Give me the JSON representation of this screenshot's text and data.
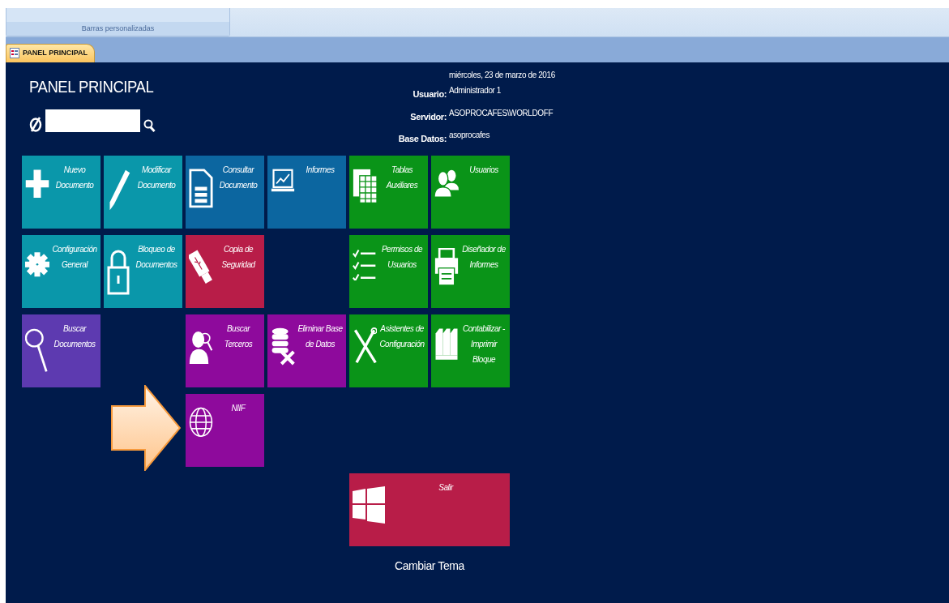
{
  "ribbon": {
    "group_label": "Barras personalizadas"
  },
  "document_tab": {
    "label": "PANEL PRINCIPAL",
    "selected": true
  },
  "panel": {
    "title": "PANEL PRINCIPAL",
    "info": {
      "date": "miércoles, 23 de marzo de 2016",
      "fields": [
        {
          "label": "Usuario:",
          "value": "Administrador 1"
        },
        {
          "label": "Servidor:",
          "value": "ASOPROCAFES\\WORLDOFF"
        },
        {
          "label": "Base Datos:",
          "value": "asoprocafes"
        }
      ]
    }
  },
  "tiles": [
    {
      "label": "Nuevo Documento",
      "color": "#0a97aa"
    },
    {
      "label": "Modificar Documento",
      "color": "#0a97aa"
    },
    {
      "label": "Consultar Documento",
      "color": "#0c66a0"
    },
    {
      "label": "Informes",
      "color": "#0c66a0"
    },
    {
      "label": "Tablas Auxiliares",
      "color": "#0a9418"
    },
    {
      "label": "Usuarios",
      "color": "#0a9418"
    },
    {
      "label": "Configuración General",
      "color": "#0a97aa"
    },
    {
      "label": "Bloqueo de Documentos",
      "color": "#0a97aa"
    },
    {
      "label": "Copia de Seguridad",
      "color": "#b81d48"
    },
    {
      "label": "Permisos de Usuarios",
      "color": "#0a9418"
    },
    {
      "label": "Diseñador de Informes",
      "color": "#0a9418"
    },
    {
      "label": "Buscar Documentos",
      "color": "#5d3ab0"
    },
    {
      "label": "Buscar Terceros",
      "color": "#8e0a9c"
    },
    {
      "label": "Eliminar Base de Datos",
      "color": "#8e0a9c"
    },
    {
      "label": "Asistentes de Configuración",
      "color": "#0a9418"
    },
    {
      "label": "Contabilizar - Imprimir Bloque",
      "color": "#0a9418"
    },
    {
      "label": "NIIF",
      "color": "#8e0a9c"
    },
    {
      "label": "Salir",
      "color": "#b81d48"
    }
  ],
  "theme_link": "Cambiar Tema"
}
